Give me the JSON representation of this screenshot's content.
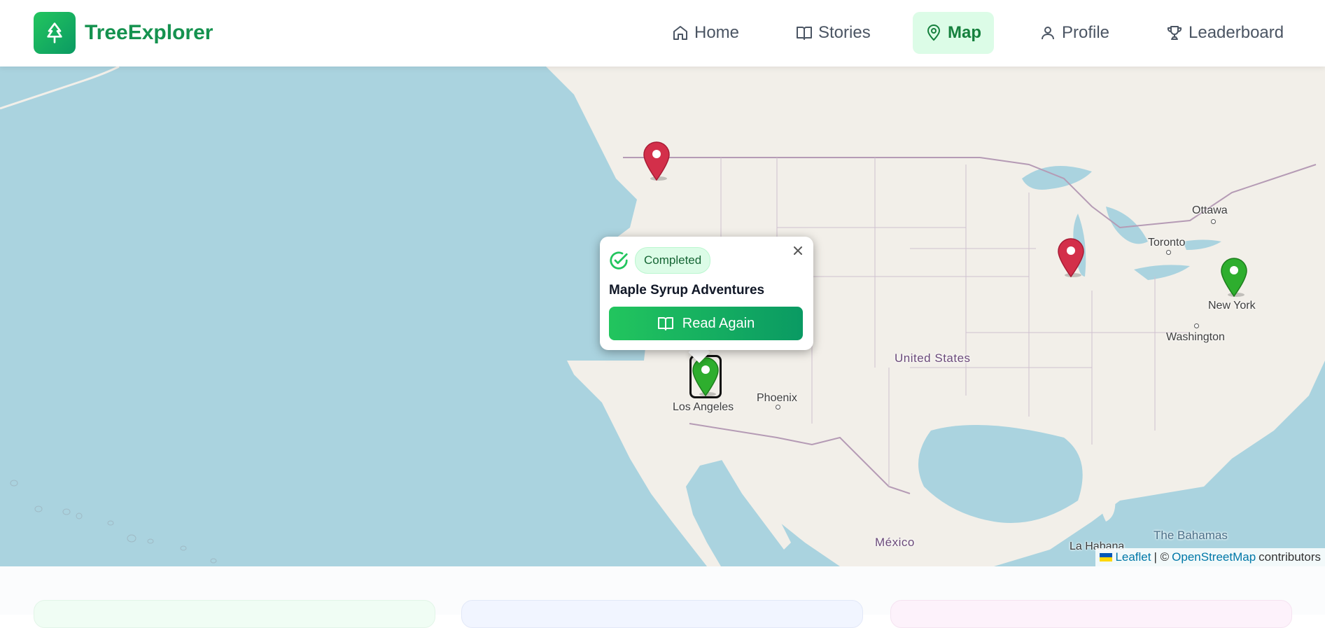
{
  "header": {
    "brand": "TreeExplorer",
    "logo_icon": "tree-icon",
    "nav": [
      {
        "label": "Home",
        "icon": "home-icon",
        "active": false
      },
      {
        "label": "Stories",
        "icon": "book-icon",
        "active": false
      },
      {
        "label": "Map",
        "icon": "map-pin-icon",
        "active": true
      },
      {
        "label": "Profile",
        "icon": "user-icon",
        "active": false
      },
      {
        "label": "Leaderboard",
        "icon": "trophy-icon",
        "active": false
      }
    ]
  },
  "map": {
    "places": {
      "ottawa": "Ottawa",
      "toronto": "Toronto",
      "new_york": "New York",
      "washington": "Washington",
      "united_states": "United States",
      "phoenix": "Phoenix",
      "los_angeles": "Los Angeles",
      "mexico": "México",
      "bahamas": "The Bahamas",
      "havana": "La Habana"
    },
    "markers": [
      {
        "name": "marker-seattle",
        "color": "#d32f4a",
        "status": "not-started"
      },
      {
        "name": "marker-chicago",
        "color": "#d32f4a",
        "status": "not-started"
      },
      {
        "name": "marker-new-york",
        "color": "#2eae2e",
        "status": "completed"
      },
      {
        "name": "marker-los-angeles",
        "color": "#2eae2e",
        "status": "completed",
        "selected": true
      }
    ],
    "popup": {
      "status_icon": "check-circle-icon",
      "status": "Completed",
      "title": "Maple Syrup Adventures",
      "button_icon": "book-icon",
      "button_label": "Read Again",
      "close_icon": "close-icon"
    },
    "attribution": {
      "leaflet": "Leaflet",
      "separator": "| ©",
      "osm": "OpenStreetMap",
      "suffix": "contributors"
    }
  },
  "colors": {
    "accent": "#16a34a",
    "water": "#aad3df",
    "land": "#f2efe9"
  }
}
